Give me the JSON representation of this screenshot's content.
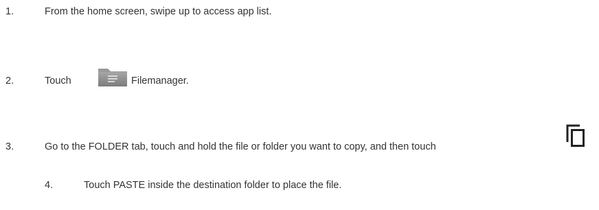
{
  "steps": [
    {
      "number": "1.",
      "text": "From the home screen, swipe up to access app list."
    },
    {
      "number": "2.",
      "prefix": "Touch",
      "icon": "folder-icon",
      "app_name": "Filemanager",
      "suffix": "."
    },
    {
      "number": "3.",
      "text_before": "Go to the ",
      "tab_name": "FOLDER",
      "text_after": " tab, touch and hold the file or folder you want to copy, and then touch",
      "icon": "copy-icon"
    },
    {
      "number": "4.",
      "text_before": "Touch ",
      "action": "PASTE",
      "text_after": " inside the destination folder to place the file."
    }
  ],
  "colors": {
    "text": "#333333",
    "folder_icon": "#8c8c8c",
    "copy_icon": "#222222"
  }
}
